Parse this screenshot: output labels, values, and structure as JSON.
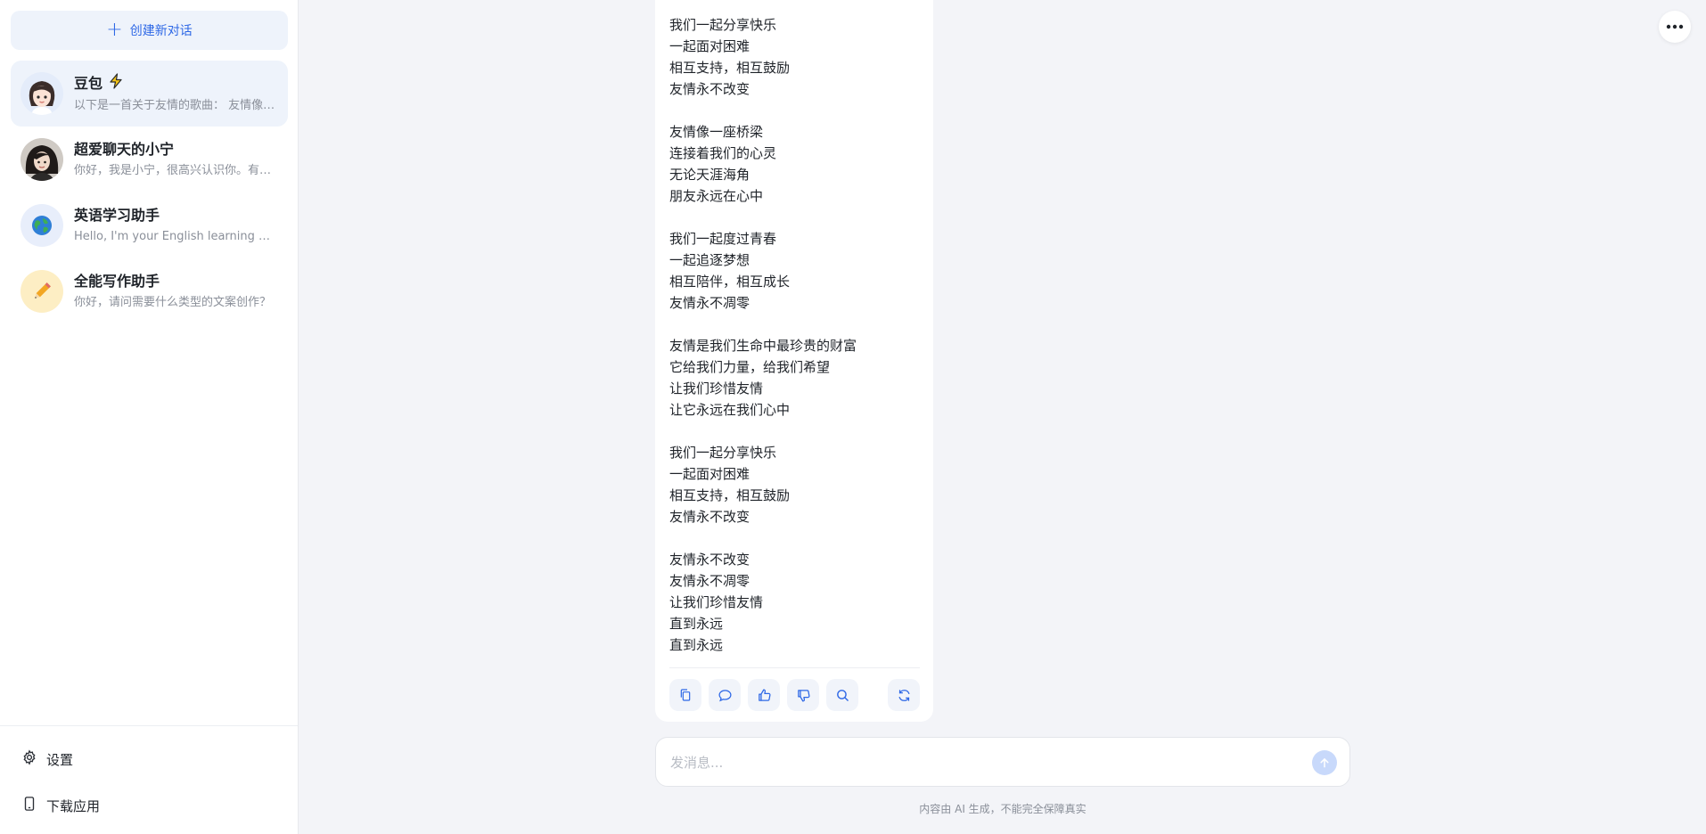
{
  "sidebar": {
    "new_chat_label": "创建新对话",
    "conversations": [
      {
        "title": "豆包",
        "badge": "lightning-icon",
        "subtitle": "以下是一首关于友情的歌曲： 友情像一座桥梁",
        "active": true
      },
      {
        "title": "超爱聊天的小宁",
        "subtitle": "你好，我是小宁，很高兴认识你。有什么想聊的吗？",
        "active": false
      },
      {
        "title": "英语学习助手",
        "subtitle": "Hello, I'm your English learning assistant.",
        "active": false
      },
      {
        "title": "全能写作助手",
        "subtitle": "你好，请问需要什么类型的文案创作？",
        "active": false
      }
    ],
    "settings_label": "设置",
    "download_label": "下载应用"
  },
  "message": {
    "lyrics": "我们一起分享快乐\n一起面对困难\n相互支持，相互鼓励\n友情永不改变\n\n友情像一座桥梁\n连接着我们的心灵\n无论天涯海角\n朋友永远在心中\n\n我们一起度过青春\n一起追逐梦想\n相互陪伴，相互成长\n友情永不凋零\n\n友情是我们生命中最珍贵的财富\n它给我们力量，给我们希望\n让我们珍惜友情\n让它永远在我们心中\n\n我们一起分享快乐\n一起面对困难\n相互支持，相互鼓励\n友情永不改变\n\n友情永不改变\n友情永不凋零\n让我们珍惜友情\n直到永远\n直到永远",
    "actions": [
      "copy-icon",
      "comment-icon",
      "thumbs-up-icon",
      "thumbs-down-icon",
      "search-icon",
      "refresh-icon"
    ]
  },
  "composer": {
    "placeholder": "发消息...",
    "value": ""
  },
  "footer": {
    "disclaimer": "内容由 AI 生成，不能完全保障真实"
  },
  "colors": {
    "accent": "#2e68e6",
    "sidebar_active": "#eef3fb",
    "page_bg": "#f3f4f8",
    "send_disabled": "#c8d9fb"
  }
}
